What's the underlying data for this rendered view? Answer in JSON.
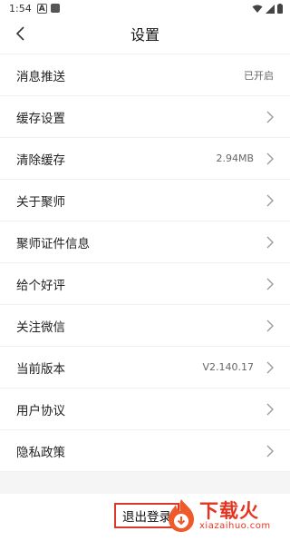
{
  "status_bar": {
    "time": "1:54"
  },
  "header": {
    "title": "设置"
  },
  "settings": [
    {
      "label": "消息推送",
      "value": "已开启"
    },
    {
      "label": "缓存设置"
    },
    {
      "label": "清除缓存",
      "value": "2.94MB"
    },
    {
      "label": "关于聚师"
    },
    {
      "label": "聚师证件信息"
    },
    {
      "label": "给个好评"
    },
    {
      "label": "关注微信"
    },
    {
      "label": "当前版本",
      "value": "V2.140.17"
    },
    {
      "label": "用户协议"
    },
    {
      "label": "隐私政策"
    }
  ],
  "logout_label": "退出登录",
  "watermark": {
    "cn": "下载火",
    "en": "xiazaihuo.com"
  },
  "colors": {
    "accent": "#e6331f",
    "border": "#d9382b",
    "divider": "#efefef"
  }
}
